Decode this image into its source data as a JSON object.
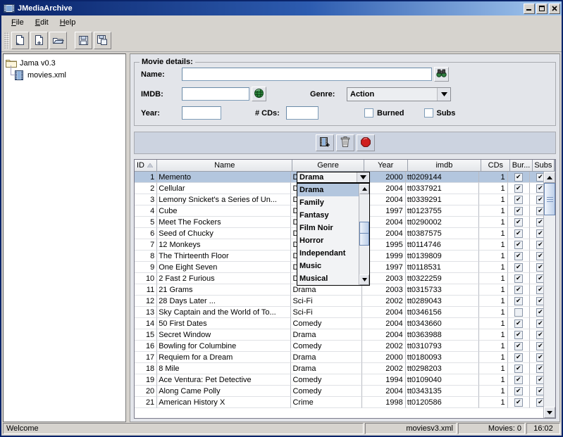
{
  "window": {
    "title": "JMediaArchive",
    "icon": "film-strip-icon",
    "minimize_label": "Minimize",
    "maximize_label": "Maximize",
    "close_label": "Close"
  },
  "menubar": [
    {
      "label": "File",
      "mnemonic": "F"
    },
    {
      "label": "Edit",
      "mnemonic": "E"
    },
    {
      "label": "Help",
      "mnemonic": "H"
    }
  ],
  "toolbar": [
    {
      "name": "new-document-button",
      "icon": "new-document-icon"
    },
    {
      "name": "add-document-button",
      "icon": "document-plus-icon"
    },
    {
      "name": "open-folder-button",
      "icon": "open-folder-icon"
    },
    {
      "name": "save-button",
      "icon": "floppy-disk-icon"
    },
    {
      "name": "save-as-button",
      "icon": "floppy-disk-copy-icon"
    }
  ],
  "tree": {
    "root": {
      "label": "Jama v0.3",
      "icon": "folder-icon"
    },
    "children": [
      {
        "label": "movies.xml",
        "icon": "film-strip-icon"
      }
    ]
  },
  "details": {
    "group_title": "Movie details:",
    "name_label": "Name:",
    "name_value": "",
    "name_search_icon": "binoculars-icon",
    "imdb_label": "IMDB:",
    "imdb_value": "",
    "imdb_icon": "globe-icon",
    "genre_label": "Genre:",
    "genre_value": "Action",
    "year_label": "Year:",
    "year_value": "",
    "cds_label": "# CDs:",
    "cds_value": "",
    "burned_label": "Burned",
    "burned_checked": false,
    "subs_label": "Subs",
    "subs_checked": false
  },
  "actions": [
    {
      "name": "add-movie-button",
      "icon": "film-plus-icon"
    },
    {
      "name": "delete-movie-button",
      "icon": "trash-icon"
    },
    {
      "name": "stop-button",
      "icon": "stop-sign-icon"
    }
  ],
  "table": {
    "columns": [
      {
        "key": "id",
        "label": "ID",
        "sort": "asc"
      },
      {
        "key": "name",
        "label": "Name"
      },
      {
        "key": "genre",
        "label": "Genre"
      },
      {
        "key": "year",
        "label": "Year"
      },
      {
        "key": "imdb",
        "label": "imdb"
      },
      {
        "key": "cds",
        "label": "CDs"
      },
      {
        "key": "burned",
        "label": "Bur..."
      },
      {
        "key": "subs",
        "label": "Subs"
      }
    ],
    "rows": [
      {
        "id": "1",
        "name": "Memento",
        "genre": "Drama",
        "year": "2000",
        "imdb": "tt0209144",
        "cds": "1",
        "burned": true,
        "subs": true,
        "selected": true
      },
      {
        "id": "2",
        "name": "Cellular",
        "genre": "Drama",
        "year": "2004",
        "imdb": "tt0337921",
        "cds": "1",
        "burned": true,
        "subs": true
      },
      {
        "id": "3",
        "name": "Lemony Snicket's a Series of Un...",
        "genre": "Drama",
        "year": "2004",
        "imdb": "tt0339291",
        "cds": "1",
        "burned": true,
        "subs": true
      },
      {
        "id": "4",
        "name": "Cube",
        "genre": "Drama",
        "year": "1997",
        "imdb": "tt0123755",
        "cds": "1",
        "burned": true,
        "subs": true
      },
      {
        "id": "5",
        "name": "Meet The Fockers",
        "genre": "Drama",
        "year": "2004",
        "imdb": "tt0290002",
        "cds": "1",
        "burned": true,
        "subs": true
      },
      {
        "id": "6",
        "name": "Seed of Chucky",
        "genre": "Drama",
        "year": "2004",
        "imdb": "tt0387575",
        "cds": "1",
        "burned": true,
        "subs": true
      },
      {
        "id": "7",
        "name": "12 Monkeys",
        "genre": "Drama",
        "year": "1995",
        "imdb": "tt0114746",
        "cds": "1",
        "burned": true,
        "subs": true
      },
      {
        "id": "8",
        "name": "The Thirteenth Floor",
        "genre": "Drama",
        "year": "1999",
        "imdb": "tt0139809",
        "cds": "1",
        "burned": true,
        "subs": true
      },
      {
        "id": "9",
        "name": "One Eight Seven",
        "genre": "Drama",
        "year": "1997",
        "imdb": "tt0118531",
        "cds": "1",
        "burned": true,
        "subs": true
      },
      {
        "id": "10",
        "name": "2 Fast 2 Furious",
        "genre": "Drama",
        "year": "2003",
        "imdb": "tt0322259",
        "cds": "1",
        "burned": true,
        "subs": true
      },
      {
        "id": "11",
        "name": "21 Grams",
        "genre": "Drama",
        "year": "2003",
        "imdb": "tt0315733",
        "cds": "1",
        "burned": true,
        "subs": true
      },
      {
        "id": "12",
        "name": "28 Days Later ...",
        "genre": "Sci-Fi",
        "year": "2002",
        "imdb": "tt0289043",
        "cds": "1",
        "burned": true,
        "subs": true
      },
      {
        "id": "13",
        "name": "Sky Captain and the World of To...",
        "genre": "Sci-Fi",
        "year": "2004",
        "imdb": "tt0346156",
        "cds": "1",
        "burned": false,
        "subs": true
      },
      {
        "id": "14",
        "name": "50 First Dates",
        "genre": "Comedy",
        "year": "2004",
        "imdb": "tt0343660",
        "cds": "1",
        "burned": true,
        "subs": true
      },
      {
        "id": "15",
        "name": "Secret Window",
        "genre": "Drama",
        "year": "2004",
        "imdb": "tt0363988",
        "cds": "1",
        "burned": true,
        "subs": true
      },
      {
        "id": "16",
        "name": "Bowling for Columbine",
        "genre": "Comedy",
        "year": "2002",
        "imdb": "tt0310793",
        "cds": "1",
        "burned": true,
        "subs": true
      },
      {
        "id": "17",
        "name": "Requiem for a Dream",
        "genre": "Drama",
        "year": "2000",
        "imdb": "tt0180093",
        "cds": "1",
        "burned": true,
        "subs": true
      },
      {
        "id": "18",
        "name": "8 Mile",
        "genre": "Drama",
        "year": "2002",
        "imdb": "tt0298203",
        "cds": "1",
        "burned": true,
        "subs": true
      },
      {
        "id": "19",
        "name": "Ace Ventura: Pet Detective",
        "genre": "Comedy",
        "year": "1994",
        "imdb": "tt0109040",
        "cds": "1",
        "burned": true,
        "subs": true
      },
      {
        "id": "20",
        "name": "Along Came Polly",
        "genre": "Comedy",
        "year": "2004",
        "imdb": "tt0343135",
        "cds": "1",
        "burned": true,
        "subs": true
      },
      {
        "id": "21",
        "name": "American History X",
        "genre": "Crime",
        "year": "1998",
        "imdb": "tt0120586",
        "cds": "1",
        "burned": true,
        "subs": true
      }
    ],
    "cell_editor": {
      "value": "Drama",
      "open": true,
      "options": [
        "Drama",
        "Family",
        "Fantasy",
        "Film Noir",
        "Horror",
        "Independant",
        "Music",
        "Musical"
      ],
      "selected": "Drama"
    }
  },
  "statusbar": {
    "message": "Welcome",
    "file": "moviesv3.xml",
    "count": "Movies: 0",
    "time": "16:02"
  },
  "colors": {
    "title_start": "#0a246a",
    "title_end": "#a6caf0",
    "panel": "#e3e5ea",
    "chrome": "#d6d3ce",
    "selection": "#b3c6de",
    "action_bar": "#ccd3e0"
  }
}
